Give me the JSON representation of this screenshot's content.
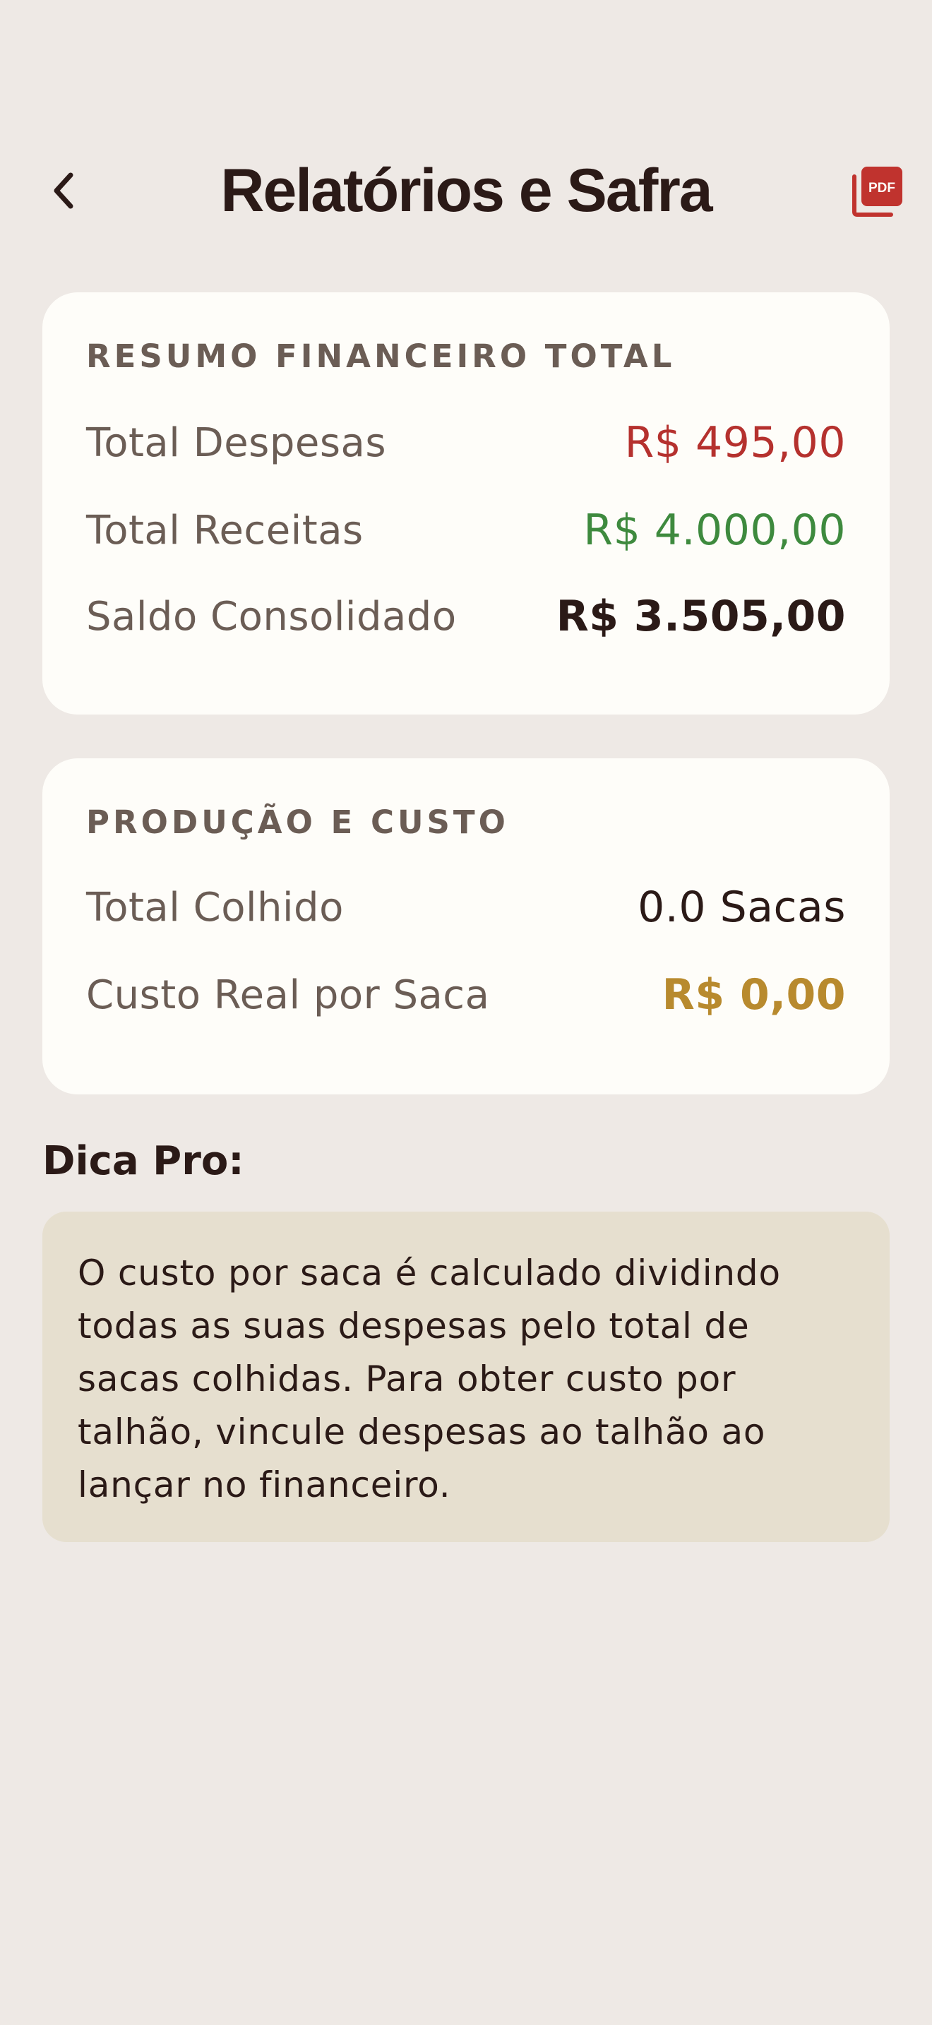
{
  "header": {
    "title": "Relatórios e Safra",
    "back_icon": "chevron-left-icon",
    "pdf_icon": "pdf-icon",
    "pdf_icon_text": "PDF"
  },
  "summary": {
    "heading": "RESUMO FINANCEIRO TOTAL",
    "rows": [
      {
        "label": "Total Despesas",
        "value": "R$ 495,00"
      },
      {
        "label": "Total Receitas",
        "value": "R$ 4.000,00"
      },
      {
        "label": "Saldo Consolidado",
        "value": "R$ 3.505,00"
      }
    ]
  },
  "production": {
    "heading": "PRODUÇÃO E CUSTO",
    "rows": [
      {
        "label": "Total Colhido",
        "value": "0.0 Sacas"
      },
      {
        "label": "Custo Real por Saca",
        "value": "R$ 0,00"
      }
    ]
  },
  "tip": {
    "title": "Dica Pro:",
    "text": "O custo por saca é calculado dividindo todas as suas despesas pelo total de sacas colhidas. Para obter custo por talhão, vincule despesas ao talhão ao lançar no financeiro."
  },
  "colors": {
    "background": "#EEE9E5",
    "card": "#FEFDF9",
    "expense": "#B5312E",
    "income": "#3E8A3E",
    "cost": "#B88A2E",
    "tip_background": "#E6DFCF",
    "pdf_icon": "#C0332E"
  }
}
